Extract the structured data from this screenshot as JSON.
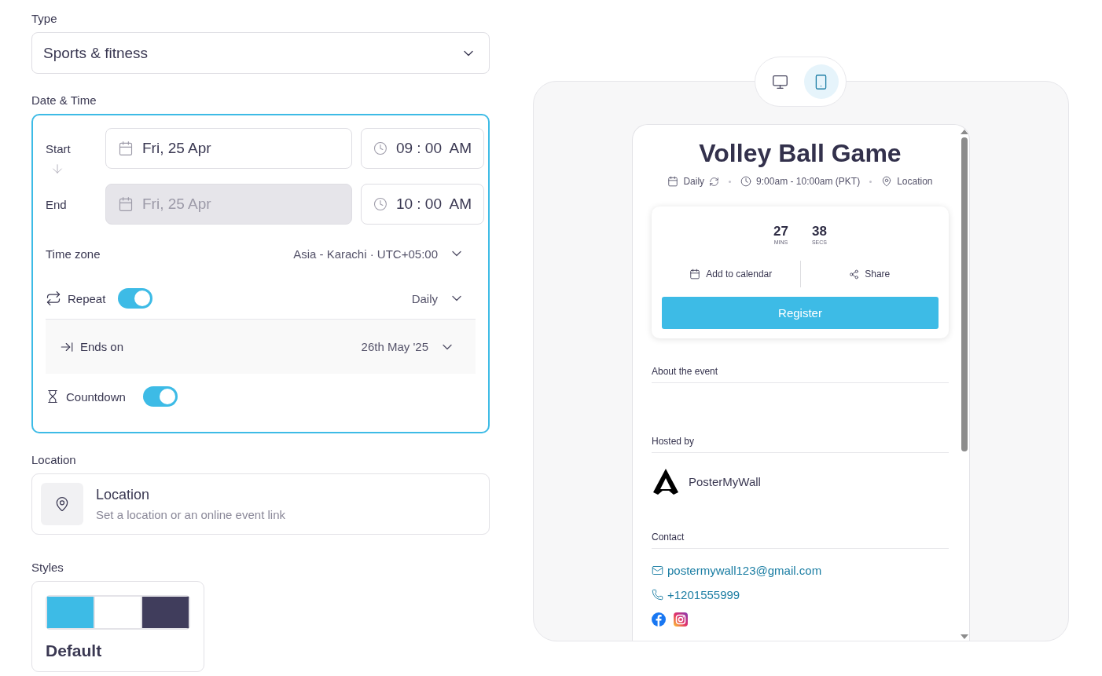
{
  "type": {
    "label": "Type",
    "value": "Sports & fitness"
  },
  "date_time": {
    "label": "Date & Time",
    "start": {
      "label": "Start",
      "date": "Fri, 25 Apr",
      "time": "09 : 00  AM",
      "disabled": false
    },
    "end": {
      "label": "End",
      "date": "Fri, 25 Apr",
      "time": "10 : 00  AM",
      "disabled": true
    },
    "timezone": {
      "label": "Time zone",
      "value": "Asia - Karachi · UTC+05:00"
    },
    "repeat": {
      "label": "Repeat",
      "on": true,
      "value": "Daily"
    },
    "ends_on": {
      "label": "Ends on",
      "value": "26th May '25"
    },
    "countdown": {
      "label": "Countdown",
      "on": true
    }
  },
  "location": {
    "label": "Location",
    "title": "Location",
    "subtitle": "Set a location or an online event link"
  },
  "styles": {
    "label": "Styles",
    "items": [
      {
        "name": "Default",
        "swatches": [
          {
            "color": "#3dbbe6"
          },
          {
            "color": "#ffffff"
          },
          {
            "color": "#403d5c"
          }
        ]
      }
    ]
  },
  "preview": {
    "view_toggle": [
      {
        "kind": "desktop",
        "selected": false
      },
      {
        "kind": "mobile",
        "selected": true
      }
    ],
    "event": {
      "title": "Volley Ball Game",
      "recurrence": "Daily",
      "time": "9:00am - 10:00am (PKT)",
      "location": "Location",
      "countdown": [
        {
          "value": "27",
          "unit": "MINS"
        },
        {
          "value": "38",
          "unit": "SECS"
        }
      ],
      "add_to_calendar": "Add to calendar",
      "share": "Share",
      "register": "Register",
      "about": {
        "heading": "About the event"
      },
      "hosted_by": {
        "heading": "Hosted by",
        "host": "PosterMyWall"
      },
      "contact": {
        "heading": "Contact",
        "email": "postermywall123@gmail.com",
        "phone": "+1201555999"
      }
    }
  }
}
